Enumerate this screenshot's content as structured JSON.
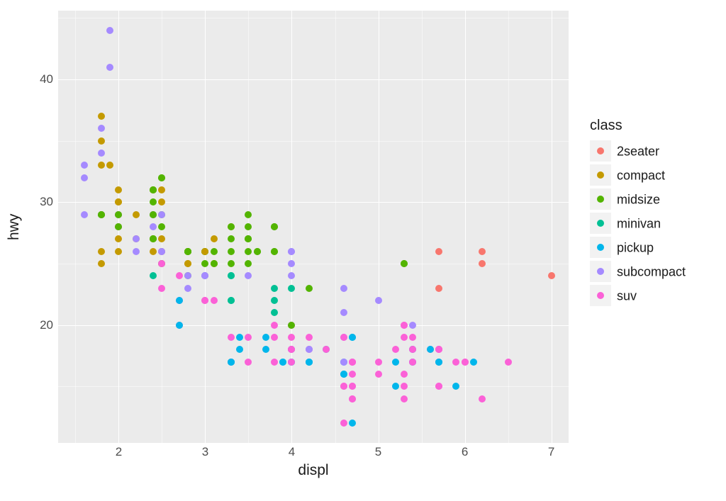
{
  "chart_data": {
    "type": "scatter",
    "xlabel": "displ",
    "ylabel": "hwy",
    "xlim": [
      1.3,
      7.2
    ],
    "ylim": [
      10.4,
      45.6
    ],
    "x_major_ticks": [
      2,
      3,
      4,
      5,
      6,
      7
    ],
    "y_major_ticks": [
      20,
      30,
      40
    ],
    "x_minor_ticks": [
      1.5,
      2.5,
      3.5,
      4.5,
      5.5,
      6.5
    ],
    "y_minor_ticks": [
      15,
      25,
      35,
      45
    ],
    "legend_title": "class",
    "series": [
      {
        "name": "2seater",
        "color": "#F8766D"
      },
      {
        "name": "compact",
        "color": "#C49A00"
      },
      {
        "name": "midsize",
        "color": "#53B400"
      },
      {
        "name": "minivan",
        "color": "#00C094"
      },
      {
        "name": "pickup",
        "color": "#00B6EB"
      },
      {
        "name": "subcompact",
        "color": "#A58AFF"
      },
      {
        "name": "suv",
        "color": "#FB61D7"
      }
    ],
    "points": [
      {
        "class": "compact",
        "x": 1.8,
        "y": 29
      },
      {
        "class": "compact",
        "x": 1.8,
        "y": 29
      },
      {
        "class": "compact",
        "x": 2.0,
        "y": 31
      },
      {
        "class": "compact",
        "x": 2.0,
        "y": 30
      },
      {
        "class": "compact",
        "x": 2.8,
        "y": 26
      },
      {
        "class": "compact",
        "x": 2.8,
        "y": 26
      },
      {
        "class": "compact",
        "x": 3.1,
        "y": 27
      },
      {
        "class": "compact",
        "x": 1.8,
        "y": 26
      },
      {
        "class": "compact",
        "x": 1.8,
        "y": 25
      },
      {
        "class": "compact",
        "x": 2.0,
        "y": 28
      },
      {
        "class": "compact",
        "x": 2.0,
        "y": 27
      },
      {
        "class": "compact",
        "x": 2.8,
        "y": 25
      },
      {
        "class": "compact",
        "x": 2.8,
        "y": 25
      },
      {
        "class": "compact",
        "x": 3.1,
        "y": 25
      },
      {
        "class": "compact",
        "x": 3.1,
        "y": 25
      },
      {
        "class": "midsize",
        "x": 2.8,
        "y": 24
      },
      {
        "class": "midsize",
        "x": 3.1,
        "y": 25
      },
      {
        "class": "midsize",
        "x": 4.2,
        "y": 23
      },
      {
        "class": "suv",
        "x": 5.3,
        "y": 20
      },
      {
        "class": "suv",
        "x": 5.3,
        "y": 15
      },
      {
        "class": "suv",
        "x": 5.3,
        "y": 20
      },
      {
        "class": "suv",
        "x": 5.7,
        "y": 17
      },
      {
        "class": "suv",
        "x": 6.0,
        "y": 17
      },
      {
        "class": "2seater",
        "x": 5.7,
        "y": 26
      },
      {
        "class": "2seater",
        "x": 5.7,
        "y": 23
      },
      {
        "class": "2seater",
        "x": 6.2,
        "y": 26
      },
      {
        "class": "2seater",
        "x": 6.2,
        "y": 25
      },
      {
        "class": "2seater",
        "x": 7.0,
        "y": 24
      },
      {
        "class": "suv",
        "x": 5.3,
        "y": 19
      },
      {
        "class": "suv",
        "x": 5.3,
        "y": 14
      },
      {
        "class": "suv",
        "x": 5.7,
        "y": 15
      },
      {
        "class": "suv",
        "x": 6.5,
        "y": 17
      },
      {
        "class": "midsize",
        "x": 2.4,
        "y": 27
      },
      {
        "class": "midsize",
        "x": 2.4,
        "y": 30
      },
      {
        "class": "midsize",
        "x": 3.1,
        "y": 26
      },
      {
        "class": "midsize",
        "x": 3.5,
        "y": 29
      },
      {
        "class": "midsize",
        "x": 3.6,
        "y": 26
      },
      {
        "class": "minivan",
        "x": 2.4,
        "y": 24
      },
      {
        "class": "minivan",
        "x": 3.0,
        "y": 24
      },
      {
        "class": "minivan",
        "x": 3.3,
        "y": 22
      },
      {
        "class": "minivan",
        "x": 3.3,
        "y": 22
      },
      {
        "class": "minivan",
        "x": 3.3,
        "y": 24
      },
      {
        "class": "minivan",
        "x": 3.3,
        "y": 24
      },
      {
        "class": "minivan",
        "x": 3.3,
        "y": 17
      },
      {
        "class": "minivan",
        "x": 3.8,
        "y": 22
      },
      {
        "class": "minivan",
        "x": 3.8,
        "y": 21
      },
      {
        "class": "minivan",
        "x": 3.8,
        "y": 23
      },
      {
        "class": "minivan",
        "x": 4.0,
        "y": 23
      },
      {
        "class": "pickup",
        "x": 3.7,
        "y": 19
      },
      {
        "class": "pickup",
        "x": 3.7,
        "y": 18
      },
      {
        "class": "pickup",
        "x": 3.9,
        "y": 17
      },
      {
        "class": "pickup",
        "x": 3.9,
        "y": 17
      },
      {
        "class": "pickup",
        "x": 4.7,
        "y": 19
      },
      {
        "class": "pickup",
        "x": 4.7,
        "y": 19
      },
      {
        "class": "pickup",
        "x": 4.7,
        "y": 12
      },
      {
        "class": "pickup",
        "x": 5.2,
        "y": 17
      },
      {
        "class": "pickup",
        "x": 5.2,
        "y": 15
      },
      {
        "class": "pickup",
        "x": 5.7,
        "y": 17
      },
      {
        "class": "pickup",
        "x": 5.9,
        "y": 15
      },
      {
        "class": "suv",
        "x": 4.7,
        "y": 17
      },
      {
        "class": "suv",
        "x": 4.7,
        "y": 17
      },
      {
        "class": "suv",
        "x": 4.7,
        "y": 16
      },
      {
        "class": "suv",
        "x": 5.2,
        "y": 18
      },
      {
        "class": "suv",
        "x": 5.7,
        "y": 18
      },
      {
        "class": "suv",
        "x": 5.7,
        "y": 18
      },
      {
        "class": "suv",
        "x": 5.7,
        "y": 18
      },
      {
        "class": "suv",
        "x": 5.9,
        "y": 17
      },
      {
        "class": "suv",
        "x": 4.6,
        "y": 15
      },
      {
        "class": "suv",
        "x": 5.4,
        "y": 17
      },
      {
        "class": "suv",
        "x": 5.4,
        "y": 18
      },
      {
        "class": "pickup",
        "x": 4.2,
        "y": 17
      },
      {
        "class": "pickup",
        "x": 4.2,
        "y": 17
      },
      {
        "class": "pickup",
        "x": 4.6,
        "y": 16
      },
      {
        "class": "pickup",
        "x": 4.6,
        "y": 16
      },
      {
        "class": "pickup",
        "x": 4.6,
        "y": 17
      },
      {
        "class": "pickup",
        "x": 5.4,
        "y": 17
      },
      {
        "class": "pickup",
        "x": 5.4,
        "y": 18
      },
      {
        "class": "subcompact",
        "x": 4.0,
        "y": 26
      },
      {
        "class": "subcompact",
        "x": 4.0,
        "y": 25
      },
      {
        "class": "subcompact",
        "x": 4.0,
        "y": 26
      },
      {
        "class": "subcompact",
        "x": 4.0,
        "y": 24
      },
      {
        "class": "subcompact",
        "x": 4.6,
        "y": 21
      },
      {
        "class": "subcompact",
        "x": 5.0,
        "y": 22
      },
      {
        "class": "subcompact",
        "x": 4.2,
        "y": 18
      },
      {
        "class": "subcompact",
        "x": 4.6,
        "y": 17
      },
      {
        "class": "subcompact",
        "x": 4.6,
        "y": 19
      },
      {
        "class": "subcompact",
        "x": 1.6,
        "y": 33
      },
      {
        "class": "subcompact",
        "x": 1.6,
        "y": 32
      },
      {
        "class": "subcompact",
        "x": 1.6,
        "y": 29
      },
      {
        "class": "subcompact",
        "x": 1.8,
        "y": 36
      },
      {
        "class": "subcompact",
        "x": 1.8,
        "y": 34
      },
      {
        "class": "subcompact",
        "x": 2.0,
        "y": 29
      },
      {
        "class": "compact",
        "x": 2.4,
        "y": 26
      },
      {
        "class": "compact",
        "x": 2.4,
        "y": 27
      },
      {
        "class": "compact",
        "x": 2.5,
        "y": 30
      },
      {
        "class": "compact",
        "x": 2.5,
        "y": 31
      },
      {
        "class": "compact",
        "x": 3.3,
        "y": 28
      },
      {
        "class": "midsize",
        "x": 2.5,
        "y": 28
      },
      {
        "class": "midsize",
        "x": 2.5,
        "y": 29
      },
      {
        "class": "midsize",
        "x": 3.0,
        "y": 26
      },
      {
        "class": "midsize",
        "x": 3.0,
        "y": 26
      },
      {
        "class": "midsize",
        "x": 3.5,
        "y": 28
      },
      {
        "class": "suv",
        "x": 3.3,
        "y": 17
      },
      {
        "class": "suv",
        "x": 3.3,
        "y": 19
      },
      {
        "class": "suv",
        "x": 4.0,
        "y": 18
      },
      {
        "class": "suv",
        "x": 5.6,
        "y": 18
      },
      {
        "class": "suv",
        "x": 3.1,
        "y": 22
      },
      {
        "class": "suv",
        "x": 3.8,
        "y": 19
      },
      {
        "class": "suv",
        "x": 3.8,
        "y": 20
      },
      {
        "class": "suv",
        "x": 3.8,
        "y": 17
      },
      {
        "class": "suv",
        "x": 4.0,
        "y": 20
      },
      {
        "class": "suv",
        "x": 4.2,
        "y": 18
      },
      {
        "class": "suv",
        "x": 4.2,
        "y": 19
      },
      {
        "class": "suv",
        "x": 4.6,
        "y": 19
      },
      {
        "class": "midsize",
        "x": 2.4,
        "y": 29
      },
      {
        "class": "midsize",
        "x": 2.4,
        "y": 27
      },
      {
        "class": "midsize",
        "x": 2.5,
        "y": 32
      },
      {
        "class": "midsize",
        "x": 2.5,
        "y": 32
      },
      {
        "class": "midsize",
        "x": 3.5,
        "y": 27
      },
      {
        "class": "midsize",
        "x": 3.5,
        "y": 26
      },
      {
        "class": "midsize",
        "x": 3.0,
        "y": 26
      },
      {
        "class": "midsize",
        "x": 3.0,
        "y": 25
      },
      {
        "class": "midsize",
        "x": 3.5,
        "y": 25
      },
      {
        "class": "midsize",
        "x": 3.3,
        "y": 27
      },
      {
        "class": "midsize",
        "x": 3.3,
        "y": 25
      },
      {
        "class": "midsize",
        "x": 4.0,
        "y": 20
      },
      {
        "class": "midsize",
        "x": 5.3,
        "y": 25
      },
      {
        "class": "suv",
        "x": 2.5,
        "y": 23
      },
      {
        "class": "suv",
        "x": 2.5,
        "y": 25
      },
      {
        "class": "suv",
        "x": 2.7,
        "y": 20
      },
      {
        "class": "suv",
        "x": 2.7,
        "y": 24
      },
      {
        "class": "suv",
        "x": 2.7,
        "y": 22
      },
      {
        "class": "compact",
        "x": 2.2,
        "y": 27
      },
      {
        "class": "compact",
        "x": 2.2,
        "y": 29
      },
      {
        "class": "compact",
        "x": 2.4,
        "y": 31
      },
      {
        "class": "compact",
        "x": 2.4,
        "y": 31
      },
      {
        "class": "compact",
        "x": 3.0,
        "y": 26
      },
      {
        "class": "subcompact",
        "x": 2.2,
        "y": 26
      },
      {
        "class": "subcompact",
        "x": 2.2,
        "y": 27
      },
      {
        "class": "subcompact",
        "x": 2.4,
        "y": 28
      },
      {
        "class": "subcompact",
        "x": 2.4,
        "y": 29
      },
      {
        "class": "subcompact",
        "x": 3.0,
        "y": 24
      },
      {
        "class": "subcompact",
        "x": 3.0,
        "y": 24
      },
      {
        "class": "subcompact",
        "x": 3.5,
        "y": 24
      },
      {
        "class": "midsize",
        "x": 2.5,
        "y": 26
      },
      {
        "class": "midsize",
        "x": 2.5,
        "y": 25
      },
      {
        "class": "midsize",
        "x": 3.3,
        "y": 26
      },
      {
        "class": "midsize",
        "x": 3.3,
        "y": 28
      },
      {
        "class": "midsize",
        "x": 3.5,
        "y": 27
      },
      {
        "class": "suv",
        "x": 4.7,
        "y": 15
      },
      {
        "class": "suv",
        "x": 5.7,
        "y": 18
      },
      {
        "class": "pickup",
        "x": 2.7,
        "y": 22
      },
      {
        "class": "pickup",
        "x": 2.7,
        "y": 20
      },
      {
        "class": "pickup",
        "x": 3.4,
        "y": 19
      },
      {
        "class": "pickup",
        "x": 3.4,
        "y": 18
      },
      {
        "class": "pickup",
        "x": 4.0,
        "y": 17
      },
      {
        "class": "suv",
        "x": 4.0,
        "y": 19
      },
      {
        "class": "suv",
        "x": 4.7,
        "y": 14
      },
      {
        "class": "suv",
        "x": 4.7,
        "y": 15
      },
      {
        "class": "pickup",
        "x": 5.7,
        "y": 17
      },
      {
        "class": "pickup",
        "x": 6.1,
        "y": 17
      },
      {
        "class": "pickup",
        "x": 4.0,
        "y": 17
      },
      {
        "class": "pickup",
        "x": 4.2,
        "y": 17
      },
      {
        "class": "pickup",
        "x": 4.4,
        "y": 18
      },
      {
        "class": "pickup",
        "x": 4.6,
        "y": 16
      },
      {
        "class": "suv",
        "x": 5.4,
        "y": 19
      },
      {
        "class": "suv",
        "x": 2.5,
        "y": 26
      },
      {
        "class": "suv",
        "x": 2.5,
        "y": 25
      },
      {
        "class": "suv",
        "x": 3.0,
        "y": 22
      },
      {
        "class": "suv",
        "x": 3.0,
        "y": 22
      },
      {
        "class": "suv",
        "x": 3.5,
        "y": 17
      },
      {
        "class": "suv",
        "x": 3.5,
        "y": 19
      },
      {
        "class": "midsize",
        "x": 3.5,
        "y": 27
      },
      {
        "class": "midsize",
        "x": 3.8,
        "y": 28
      },
      {
        "class": "midsize",
        "x": 3.8,
        "y": 28
      },
      {
        "class": "midsize",
        "x": 3.8,
        "y": 26
      },
      {
        "class": "midsize",
        "x": 3.8,
        "y": 26
      },
      {
        "class": "midsize",
        "x": 5.3,
        "y": 25
      },
      {
        "class": "suv",
        "x": 4.0,
        "y": 17
      },
      {
        "class": "suv",
        "x": 4.6,
        "y": 15
      },
      {
        "class": "suv",
        "x": 5.0,
        "y": 16
      },
      {
        "class": "pickup",
        "x": 3.3,
        "y": 17
      },
      {
        "class": "pickup",
        "x": 3.3,
        "y": 17
      },
      {
        "class": "pickup",
        "x": 4.0,
        "y": 18
      },
      {
        "class": "pickup",
        "x": 5.6,
        "y": 18
      },
      {
        "class": "suv",
        "x": 5.4,
        "y": 17
      },
      {
        "class": "suv",
        "x": 5.4,
        "y": 18
      },
      {
        "class": "suv",
        "x": 4.0,
        "y": 18
      },
      {
        "class": "suv",
        "x": 4.0,
        "y": 18
      },
      {
        "class": "subcompact",
        "x": 4.6,
        "y": 23
      },
      {
        "class": "subcompact",
        "x": 5.4,
        "y": 20
      },
      {
        "class": "suv",
        "x": 4.6,
        "y": 12
      },
      {
        "class": "suv",
        "x": 5.0,
        "y": 17
      },
      {
        "class": "suv",
        "x": 5.3,
        "y": 16
      },
      {
        "class": "suv",
        "x": 5.7,
        "y": 15
      },
      {
        "class": "suv",
        "x": 6.0,
        "y": 17
      },
      {
        "class": "suv",
        "x": 6.2,
        "y": 14
      },
      {
        "class": "subcompact",
        "x": 4.2,
        "y": 18
      },
      {
        "class": "midsize",
        "x": 2.4,
        "y": 29
      },
      {
        "class": "midsize",
        "x": 2.4,
        "y": 27
      },
      {
        "class": "midsize",
        "x": 2.4,
        "y": 31
      },
      {
        "class": "midsize",
        "x": 2.4,
        "y": 31
      },
      {
        "class": "midsize",
        "x": 2.8,
        "y": 26
      },
      {
        "class": "midsize",
        "x": 2.8,
        "y": 26
      },
      {
        "class": "compact",
        "x": 1.9,
        "y": 33
      },
      {
        "class": "compact",
        "x": 2.0,
        "y": 26
      },
      {
        "class": "compact",
        "x": 2.0,
        "y": 30
      },
      {
        "class": "compact",
        "x": 2.0,
        "y": 29
      },
      {
        "class": "compact",
        "x": 1.8,
        "y": 33
      },
      {
        "class": "compact",
        "x": 1.8,
        "y": 35
      },
      {
        "class": "compact",
        "x": 1.8,
        "y": 37
      },
      {
        "class": "compact",
        "x": 2.5,
        "y": 27
      },
      {
        "class": "subcompact",
        "x": 1.9,
        "y": 44
      },
      {
        "class": "subcompact",
        "x": 1.9,
        "y": 41
      },
      {
        "class": "subcompact",
        "x": 2.5,
        "y": 29
      },
      {
        "class": "subcompact",
        "x": 2.5,
        "y": 26
      },
      {
        "class": "subcompact",
        "x": 1.8,
        "y": 29
      },
      {
        "class": "subcompact",
        "x": 1.8,
        "y": 29
      },
      {
        "class": "subcompact",
        "x": 2.0,
        "y": 28
      },
      {
        "class": "subcompact",
        "x": 2.0,
        "y": 29
      },
      {
        "class": "subcompact",
        "x": 2.8,
        "y": 23
      },
      {
        "class": "subcompact",
        "x": 2.8,
        "y": 24
      },
      {
        "class": "midsize",
        "x": 1.8,
        "y": 29
      },
      {
        "class": "midsize",
        "x": 1.8,
        "y": 29
      },
      {
        "class": "midsize",
        "x": 2.0,
        "y": 28
      },
      {
        "class": "midsize",
        "x": 2.0,
        "y": 29
      },
      {
        "class": "midsize",
        "x": 2.8,
        "y": 26
      },
      {
        "class": "midsize",
        "x": 2.8,
        "y": 26
      },
      {
        "class": "midsize",
        "x": 3.6,
        "y": 26
      },
      {
        "class": "suv",
        "x": 4.4,
        "y": 18
      },
      {
        "class": "suv",
        "x": 4.7,
        "y": 14
      },
      {
        "class": "suv",
        "x": 4.7,
        "y": 17
      }
    ]
  }
}
